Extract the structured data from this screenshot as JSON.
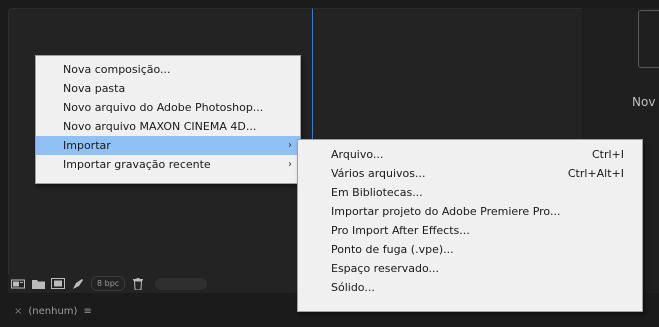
{
  "new_menu": {
    "items": [
      {
        "label": "Nova composição..."
      },
      {
        "label": "Nova pasta"
      },
      {
        "label": "Novo arquivo do Adobe Photoshop..."
      },
      {
        "label": "Novo arquivo MAXON CINEMA 4D..."
      },
      {
        "label": "Importar",
        "submenu": true,
        "active": true
      },
      {
        "label": "Importar gravação recente",
        "submenu": true
      }
    ]
  },
  "import_submenu": {
    "items": [
      {
        "label": "Arquivo...",
        "shortcut": "Ctrl+I"
      },
      {
        "label": "Vários arquivos...",
        "shortcut": "Ctrl+Alt+I"
      },
      {
        "label": "Em Bibliotecas..."
      },
      {
        "label": "Importar projeto do Adobe Premiere Pro..."
      },
      {
        "label": "Pro Import After Effects..."
      },
      {
        "label": "Ponto de fuga (.vpe)..."
      },
      {
        "label": "Espaço reservado..."
      },
      {
        "label": "Sólido..."
      }
    ]
  },
  "toolbar": {
    "bpc_label": "8 bpc",
    "icons": [
      "interpret-footage-icon",
      "new-folder-icon",
      "new-composition-icon",
      "pen-icon",
      "trash-icon"
    ]
  },
  "right_panel": {
    "label": "Nov"
  },
  "statusbar": {
    "close_glyph": "×",
    "label": "(nenhum)",
    "menu_glyph": "≡"
  },
  "colors": {
    "menu_background": "#f0f0f0",
    "menu_highlight": "#8fc1f4",
    "panel_background": "#232323",
    "accent_border": "#2f7fd6"
  }
}
